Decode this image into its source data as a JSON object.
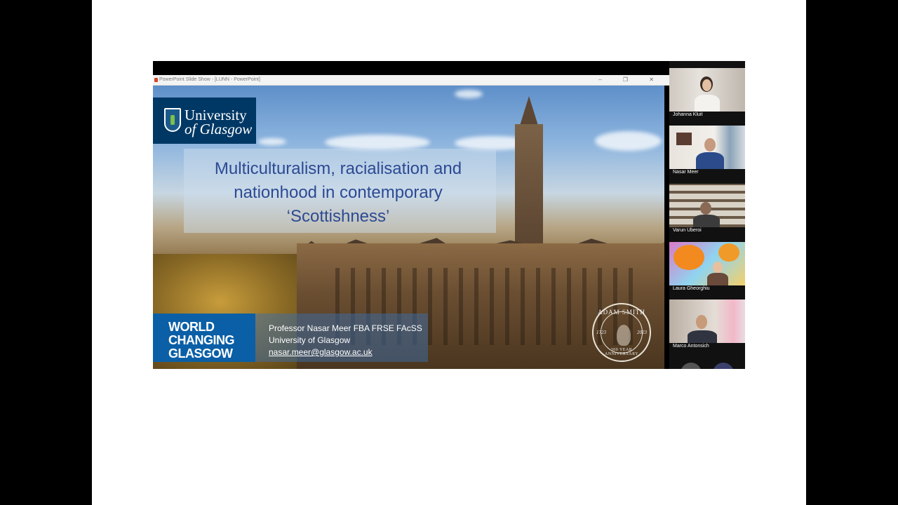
{
  "window": {
    "title": "PowerPoint Slide Show - [LUNN - PowerPoint]",
    "controls": "‒ ❐ ✕"
  },
  "slide": {
    "logo_line1": "University",
    "logo_line2": "of Glasgow",
    "title_line1": "Multiculturalism, racialisation and",
    "title_line2": "nationhood in contemporary",
    "title_line3": "‘Scottishness’",
    "banner_line1": "WORLD",
    "banner_line2": "CHANGING",
    "banner_line3": "GLASGOW",
    "speaker_name": "Professor Nasar Meer FBA FRSE FAcSS",
    "speaker_affiliation": "University of Glasgow",
    "speaker_email": "nasar.meer@glasgow.ac.uk",
    "seal_top": "ADAM SMITH",
    "seal_year_left": "1723",
    "seal_year_right": "2023",
    "seal_bottom": "300 YEAR ANNIVERSARY"
  },
  "participants": [
    {
      "name": "Johanna Kluit"
    },
    {
      "name": "Nasar Meer"
    },
    {
      "name": "Varun Uberoi"
    },
    {
      "name": "Laura Gheorghiu"
    },
    {
      "name": "Marco Antonsich"
    }
  ]
}
